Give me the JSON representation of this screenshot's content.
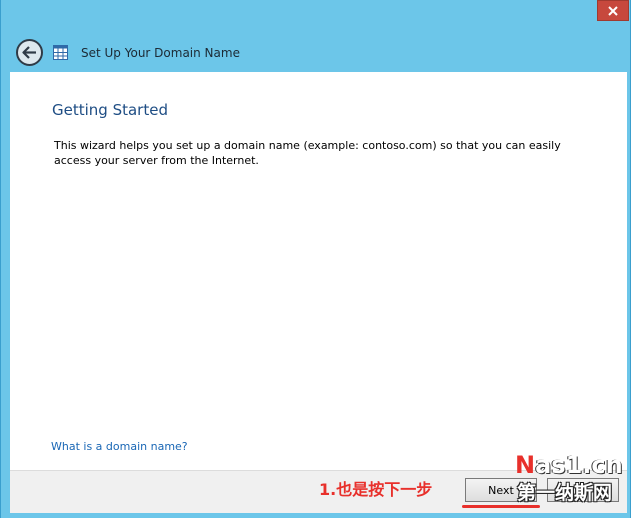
{
  "window": {
    "title": "Set Up Your Domain Name"
  },
  "icons": {
    "back": "back-arrow-icon",
    "app": "wizard-app-icon",
    "close": "close-icon"
  },
  "content": {
    "heading": "Getting Started",
    "description": "This wizard helps you set up a domain name (example: contoso.com) so that you can easily access your server from the Internet.",
    "help_link": "What is a domain name?"
  },
  "footer": {
    "annotation": "1.也是按下一步",
    "next_label": "Next",
    "cancel_label": ""
  },
  "watermark": {
    "logo_first": "N",
    "logo_rest": "as1.cn",
    "subtitle": "第一纳斯网"
  },
  "colors": {
    "frame": "#6cc6e9",
    "close_button": "#c7483d",
    "heading": "#1e4d84",
    "link": "#1a67b5",
    "annotation": "#e8302b"
  }
}
